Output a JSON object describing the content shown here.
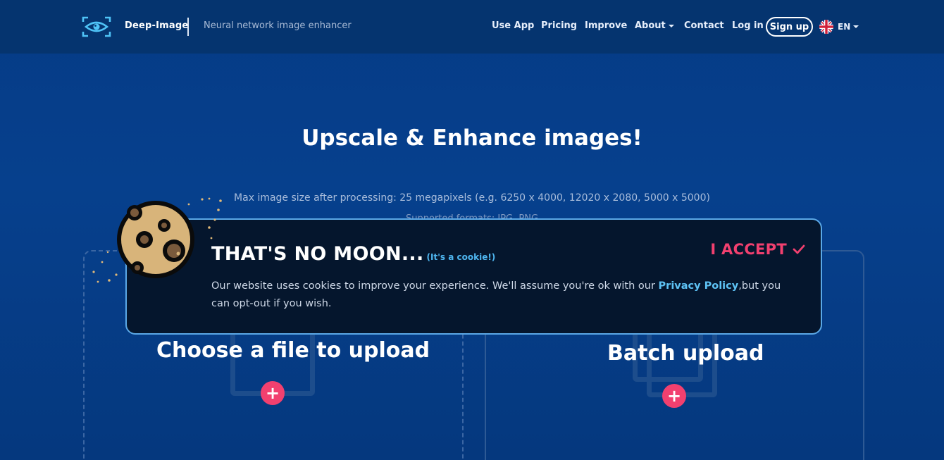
{
  "header": {
    "brand_name": "Deep-Image",
    "tagline": "Neural network image enhancer",
    "nav": {
      "use_app": "Use App",
      "pricing": "Pricing",
      "improve": "Improve",
      "about": "About",
      "contact": "Contact",
      "login": "Log in",
      "signup": "Sign up",
      "language": "EN"
    }
  },
  "hero": {
    "title": "Upscale & Enhance images!",
    "max_size": "Max image size after processing: 25 megapixels (e.g. 6250 x 4000, 12020 x 2080, 5000 x 5000)",
    "formats": "Supported formats: JPG, PNG"
  },
  "upload": {
    "single_title": "Choose a file to upload",
    "batch_title": "Batch upload",
    "plus": "+"
  },
  "cookie": {
    "title": "THAT'S NO MOON...",
    "subtitle": "(It's a cookie!)",
    "body_before": "Our website uses cookies to improve your experience. We'll assume you're ok with our ",
    "privacy_link": "Privacy Policy",
    "body_after": ",but you can opt-out if you wish.",
    "accept": "I ACCEPT"
  },
  "colors": {
    "background": "#053b86",
    "accent": "#f2406f",
    "link": "#5ec3f5",
    "banner": "#05162d"
  },
  "icons": [
    "eye-logo-icon",
    "caret-down-icon",
    "uk-flag-icon",
    "cookie-icon",
    "checkmark-icon",
    "upload-icon",
    "plus-icon"
  ]
}
